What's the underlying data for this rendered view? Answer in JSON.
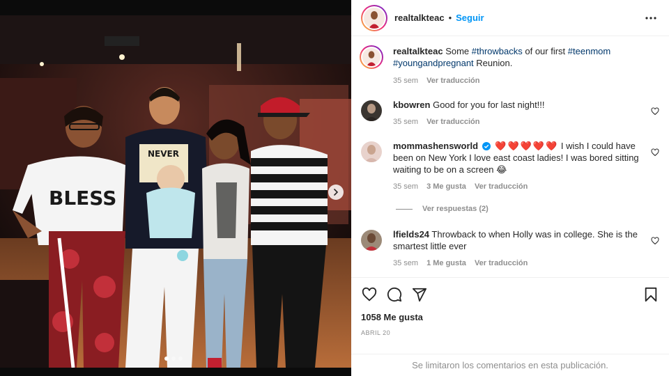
{
  "post": {
    "username": "realtalkteac",
    "separator": "•",
    "follow_label": "Seguir",
    "more_icon": "more-horizontal-icon"
  },
  "caption": {
    "username": "realtalkteac",
    "text_before": "Some ",
    "tag1": "#throwbacks",
    "text_mid": " of our first ",
    "tag2": "#teenmom",
    "tag3": "#youngandpregnant",
    "text_after": " Reunion.",
    "time": "35 sem",
    "translate": "Ver traducción"
  },
  "comments": [
    {
      "username": "kbowren",
      "text": "Good for you for last night!!!",
      "time": "35 sem",
      "likes": "",
      "translate": "Ver traducción"
    },
    {
      "username": "mommashensworld",
      "hearts": "❤️❤️❤️❤️❤️",
      "text": " I wish I could have been on New York I love east coast ladies! I was bored sitting waiting to be on a screen 😂",
      "time": "35 sem",
      "likes": "3 Me gusta",
      "translate": "Ver traducción",
      "replies": "Ver respuestas (2)"
    },
    {
      "username": "lfields24",
      "text": "Throwback to when Holly was in college. She is the smartest little ever",
      "time": "35 sem",
      "likes": "1 Me gusta",
      "translate": "Ver traducción"
    }
  ],
  "footer": {
    "likes": "1058 Me gusta",
    "date": "ABRIL 20",
    "comments_disabled": "Se limitaron los comentarios en esta publicación."
  },
  "photo": {
    "shirt_text": "BLESS",
    "shirt_text2": "NEVER",
    "carousel_total": 3,
    "carousel_active": 1
  },
  "colors": {
    "accent": "#0095f6",
    "verified": "#0095f6",
    "heart": "#e0245e"
  }
}
